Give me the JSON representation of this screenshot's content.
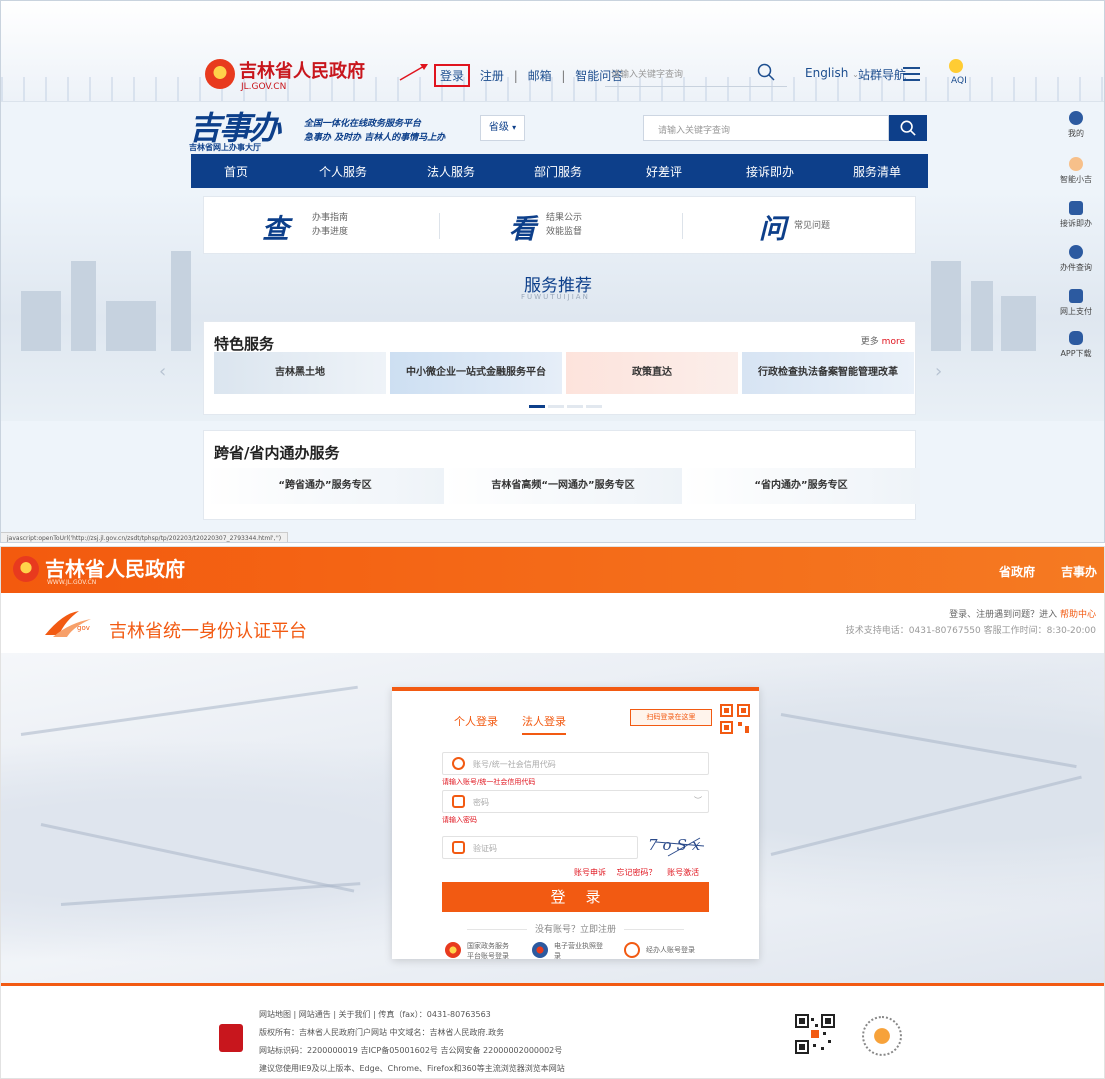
{
  "top": {
    "brand": {
      "title": "吉林省人民政府",
      "sub": "JL.GOV.CN"
    },
    "toplinks": {
      "login": "登录",
      "register": "注册",
      "sep": "|",
      "mail": "邮箱",
      "ask": "智能问答"
    },
    "search_placeholder": "请输入关键字查询",
    "english": "English",
    "nav_sites": "站群导航",
    "weather_label": "AQI",
    "sjb": {
      "logo": "吉事办",
      "logo_sub": "吉林省网上办事大厅",
      "slogan1": "全国一体化在线政务服务平台",
      "slogan2": "急事办 及时办 吉林人的事情马上办",
      "province": "省级",
      "search_placeholder": "请输入关键字查询"
    },
    "mainnav": [
      "首页",
      "个人服务",
      "法人服务",
      "部门服务",
      "好差评",
      "接诉即办",
      "服务清单"
    ],
    "quick": [
      {
        "glyph": "查",
        "l1": "办事指南",
        "l2": "办事进度"
      },
      {
        "glyph": "看",
        "l1": "结果公示",
        "l2": "效能监督"
      },
      {
        "glyph": "问",
        "l1": "常见问题",
        "l2": ""
      }
    ],
    "recommend": {
      "title": "服务推荐",
      "sub": "FUWUTUIJIAN"
    },
    "special": {
      "title": "特色服务",
      "more_cn": "更多",
      "more_en": "more",
      "tiles": [
        "吉林黑土地",
        "中小微企业一站式金融服务平台",
        "政策直达",
        "行政检查执法备案智能管理改革"
      ]
    },
    "cross": {
      "title": "跨省/省内通办服务",
      "items": [
        "“跨省通办”服务专区",
        "吉林省高频“一网通办”服务专区",
        "“省内通办”服务专区"
      ]
    },
    "right_bar": [
      "我的",
      "智能小吉",
      "接诉即办",
      "办件查询",
      "网上支付",
      "APP下载"
    ],
    "status_url": "javascript:openToUrl('http://zsj.jl.gov.cn/zsdt/tphsp/tp/202203/t20220307_2793344.html','')"
  },
  "bottom": {
    "bar": {
      "title": "吉林省人民政府",
      "sub": "WWW.JL.GOV.CN",
      "links": [
        "省政府",
        "吉事办"
      ]
    },
    "auth": {
      "logo_text": "gov",
      "title": "吉林省统一身份认证平台",
      "help_prefix": "登录、注册遇到问题？进入",
      "help_link": "帮助中心",
      "support": "技术支持电话：0431-80767550  客服工作时间：8:30-20:00"
    },
    "card": {
      "tab_person": "个人登录",
      "tab_legal": "法人登录",
      "qr_tip": "扫码登录在这里",
      "account_placeholder": "账号/统一社会信用代码",
      "account_error": "请输入账号/统一社会信用代码",
      "password_placeholder": "密码",
      "password_error": "请输入密码",
      "captcha_placeholder": "验证码",
      "captcha_text": "7oSx",
      "link_apply": "账号申诉",
      "link_forgot": "忘记密码？",
      "link_activate": "账号激活",
      "login_button": "登录",
      "no_account": "没有账号？立即注册",
      "alt1_l1": "国家政务服务",
      "alt1_l2": "平台账号登录",
      "alt2_l1": "电子营业执照登",
      "alt2_l2": "录",
      "alt3": "经办人账号登录"
    },
    "footer": {
      "line1": "网站地图  |  网站通告  |  关于我们  |  传真（fax）：0431-80763563",
      "line2": "版权所有：吉林省人民政府门户网站    中文域名：吉林省人民政府.政务",
      "line3": "网站标识码：2200000019   吉ICP备05001602号   吉公网安备 22000002000002号",
      "line4": "建议您使用IE9及以上版本、Edge、Chrome、Firefox和360等主流浏览器浏览本网站"
    }
  },
  "colors": {
    "gov_blue": "#0d3f8a",
    "gov_red": "#c8161d",
    "orange": "#f25a12"
  }
}
